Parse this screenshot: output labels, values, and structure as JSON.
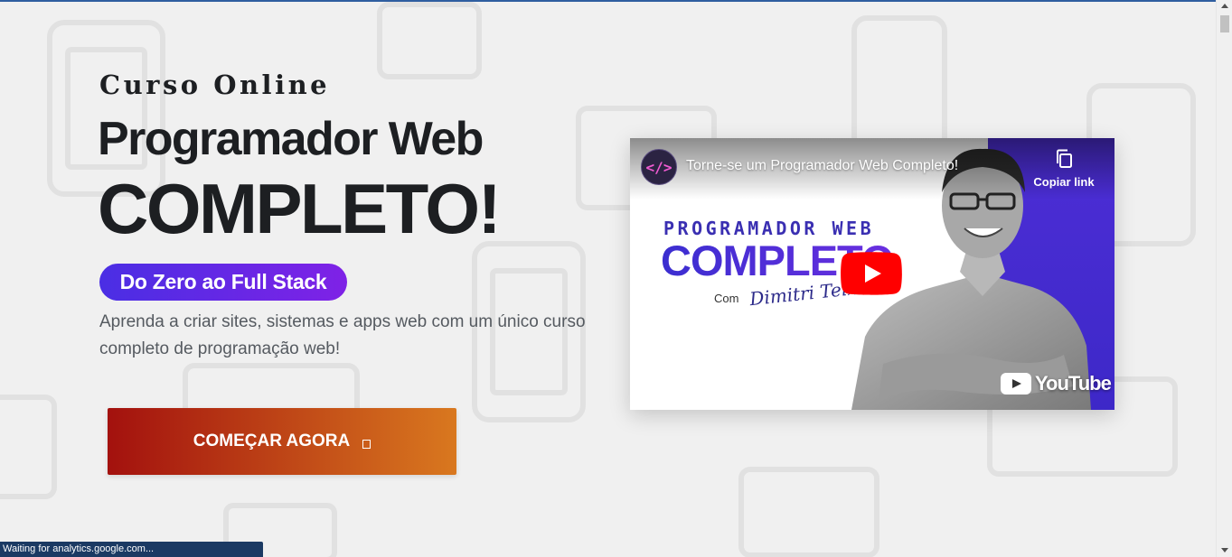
{
  "hero": {
    "eyebrow": "Curso Online",
    "headline_line1": "Programador Web",
    "headline_line2": "COMPLETO!",
    "pill": "Do Zero ao Full Stack",
    "subtitle": "Aprenda a criar sites, sistemas e apps web com um único curso completo de programação web!",
    "cta_label": "COMEÇAR AGORA",
    "cta_icon": "square-icon"
  },
  "video": {
    "channel_logo": "</>",
    "title": "Torne-se um Programador Web Completo!",
    "copy_link_label": "Copiar link",
    "thumbnail_line1": "PROGRAMADOR WEB",
    "thumbnail_line2": "COMPLETO",
    "thumbnail_with": "Com",
    "thumbnail_signature": "Dimitri Teixeira",
    "provider": "YouTube"
  },
  "status_bar": "Waiting for analytics.google.com...",
  "colors": {
    "background": "#f0f0f0",
    "pill_gradient": [
      "#4a2ee4",
      "#7f22e6"
    ],
    "cta_gradient": [
      "#a3110e",
      "#d9781f"
    ],
    "youtube_red": "#ff0000",
    "status_bar": "#1b3a63"
  }
}
